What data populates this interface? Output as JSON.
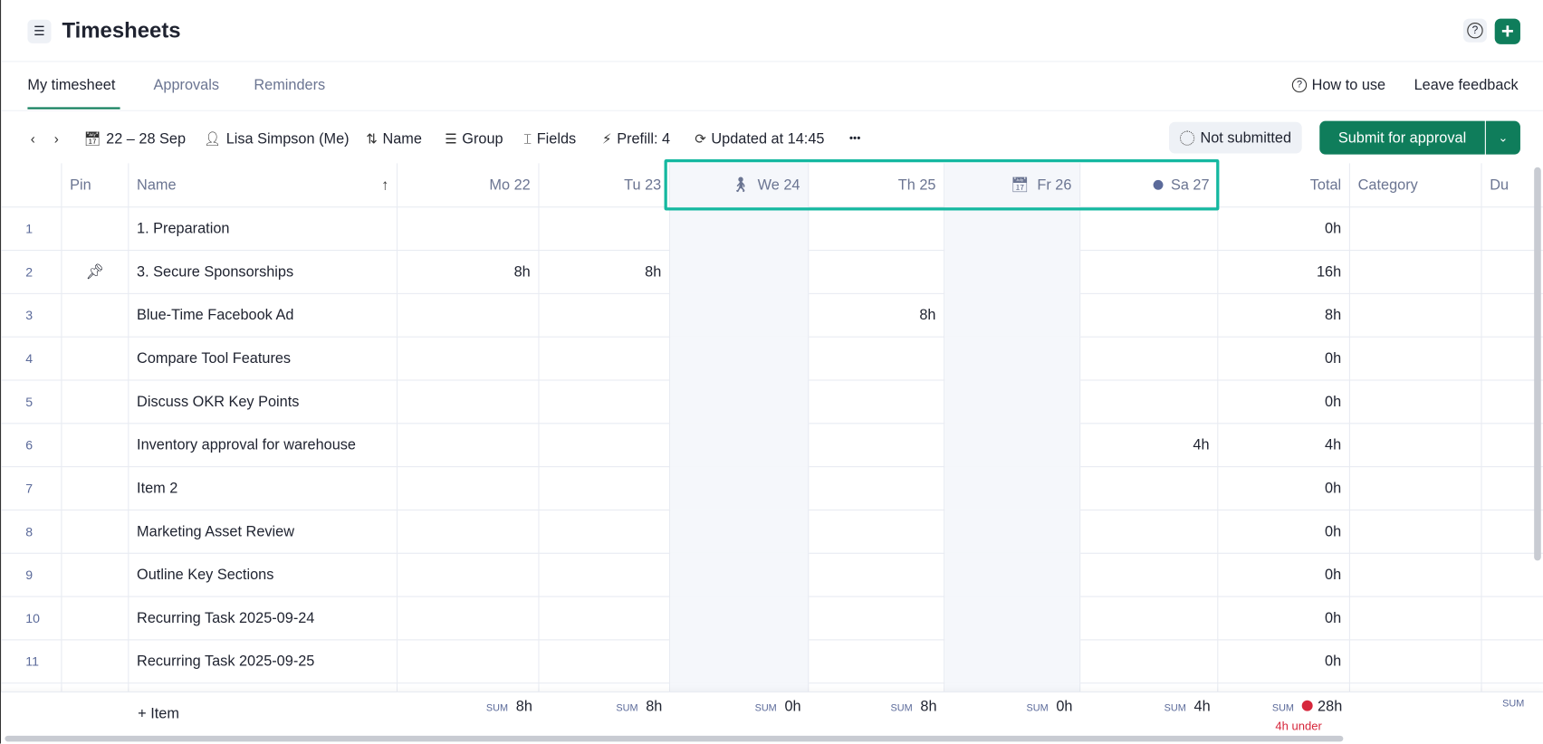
{
  "header": {
    "title": "Timesheets",
    "menu_icon": "hamburger-icon",
    "help_icon": "question-icon",
    "add_icon": "plus-icon",
    "accent": "#0f7d5b"
  },
  "tabs": [
    {
      "label": "My timesheet",
      "active": true
    },
    {
      "label": "Approvals"
    },
    {
      "label": "Reminders"
    }
  ],
  "top_links": {
    "how_to_use": "How to use",
    "leave_feedback": "Leave feedback"
  },
  "toolbar": {
    "date_range": "22 – 28 Sep",
    "user": "Lisa Simpson (Me)",
    "sort": "Name",
    "group": "Group",
    "fields": "Fields",
    "prefill": "Prefill: 4",
    "updated": "Updated at 14:45",
    "more": "•••",
    "status": "Not submitted",
    "submit": "Submit for approval"
  },
  "columns": {
    "pin": "Pin",
    "name": "Name",
    "days": [
      "Mo 22",
      "Tu 23",
      "We 24",
      "Th 25",
      "Fr 26",
      "Sa 27"
    ],
    "total": "Total",
    "category": "Category",
    "extra": "Du"
  },
  "highlight_color": "#14b8a0",
  "rows": [
    {
      "n": "1",
      "name": "1. Preparation",
      "pinned": false,
      "hours": [
        "",
        "",
        "",
        "",
        "",
        ""
      ],
      "total": "0h"
    },
    {
      "n": "2",
      "name": "3. Secure Sponsorships",
      "pinned": true,
      "hours": [
        "8h",
        "8h",
        "",
        "",
        "",
        ""
      ],
      "total": "16h"
    },
    {
      "n": "3",
      "name": "Blue-Time Facebook Ad",
      "pinned": false,
      "hours": [
        "",
        "",
        "",
        "8h",
        "",
        ""
      ],
      "total": "8h"
    },
    {
      "n": "4",
      "name": "Compare Tool Features",
      "pinned": false,
      "hours": [
        "",
        "",
        "",
        "",
        "",
        ""
      ],
      "total": "0h"
    },
    {
      "n": "5",
      "name": "Discuss OKR Key Points",
      "pinned": false,
      "hours": [
        "",
        "",
        "",
        "",
        "",
        ""
      ],
      "total": "0h"
    },
    {
      "n": "6",
      "name": "Inventory approval for warehouse",
      "pinned": false,
      "hours": [
        "",
        "",
        "",
        "",
        "",
        "4h"
      ],
      "total": "4h"
    },
    {
      "n": "7",
      "name": "Item 2",
      "pinned": false,
      "hours": [
        "",
        "",
        "",
        "",
        "",
        ""
      ],
      "total": "0h"
    },
    {
      "n": "8",
      "name": "Marketing Asset Review",
      "pinned": false,
      "hours": [
        "",
        "",
        "",
        "",
        "",
        ""
      ],
      "total": "0h"
    },
    {
      "n": "9",
      "name": "Outline Key Sections",
      "pinned": false,
      "hours": [
        "",
        "",
        "",
        "",
        "",
        ""
      ],
      "total": "0h"
    },
    {
      "n": "10",
      "name": "Recurring Task 2025-09-24",
      "pinned": false,
      "hours": [
        "",
        "",
        "",
        "",
        "",
        ""
      ],
      "total": "0h"
    },
    {
      "n": "11",
      "name": "Recurring Task 2025-09-25",
      "pinned": false,
      "hours": [
        "",
        "",
        "",
        "",
        "",
        ""
      ],
      "total": "0h"
    }
  ],
  "footer": {
    "add_item": "Item",
    "sum_label": "SUM",
    "sums": [
      "8h",
      "8h",
      "0h",
      "8h",
      "0h",
      "4h"
    ],
    "total": "28h",
    "under": "4h under"
  }
}
